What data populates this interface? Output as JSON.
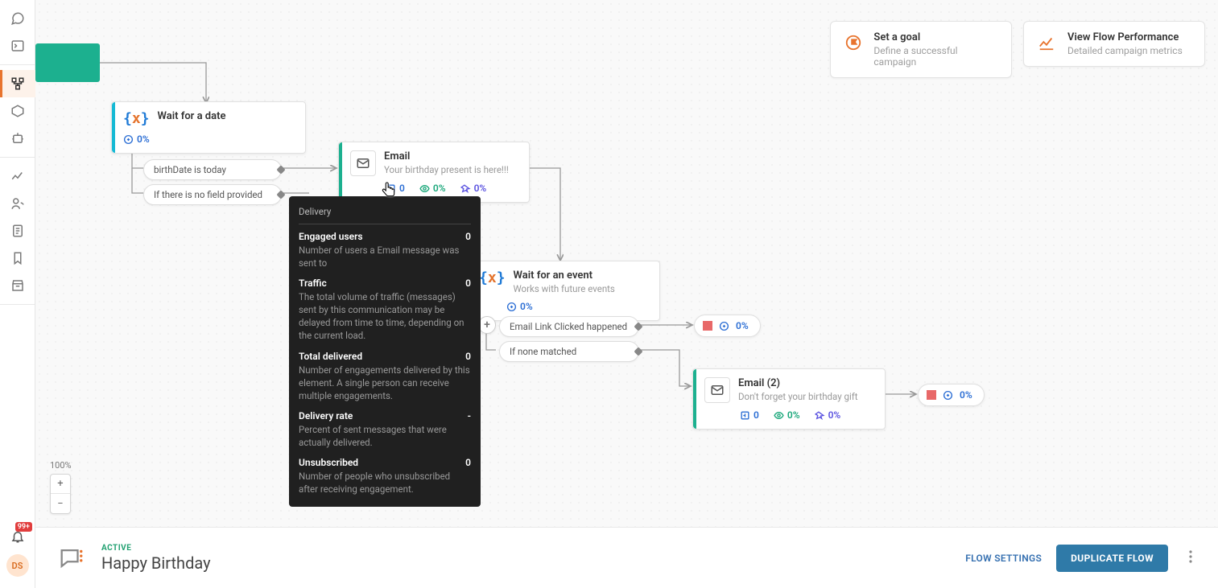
{
  "sidebar": {
    "notification_badge": "99+",
    "avatar": "DS"
  },
  "top_cards": {
    "goal": {
      "title": "Set a goal",
      "subtitle": "Define a successful campaign"
    },
    "performance": {
      "title": "View Flow Performance",
      "subtitle": "Detailed campaign metrics"
    }
  },
  "zoom": {
    "label": "100%"
  },
  "nodes": {
    "wait_date": {
      "title": "Wait for a date",
      "stat": "0%"
    },
    "email1": {
      "title": "Email",
      "subtitle": "Your birthday present is here!!!",
      "s1": "0",
      "s2": "0%",
      "s3": "0%"
    },
    "wait_event": {
      "title": "Wait for an event",
      "subtitle": "Works with future events",
      "stat": "0%"
    },
    "email2": {
      "title": "Email (2)",
      "subtitle": "Don't forget your birthday gift",
      "s1": "0",
      "s2": "0%",
      "s3": "0%"
    }
  },
  "pills": {
    "cond_birth": "birthDate is today",
    "cond_nofield": "If there is no field provided",
    "cond_click": "Email Link Clicked happened",
    "cond_nomatch": "If none matched"
  },
  "endpills": {
    "a": "0%",
    "b": "0%"
  },
  "tooltip": {
    "header": "Delivery",
    "rows": [
      {
        "t": "Engaged users",
        "v": "0",
        "d": "Number of users a Email message was sent to"
      },
      {
        "t": "Traffic",
        "v": "0",
        "d": "The total volume of traffic (messages) sent by this communication may be delayed from time to time, depending on the current load."
      },
      {
        "t": "Total delivered",
        "v": "0",
        "d": "Number of engagements delivered by this element. A single person can receive multiple engagements."
      },
      {
        "t": "Delivery rate",
        "v": "-",
        "d": "Percent of sent messages that were actually delivered."
      },
      {
        "t": "Unsubscribed",
        "v": "0",
        "d": "Number of people who unsubscribed after receiving engagement."
      }
    ]
  },
  "footer": {
    "status": "ACTIVE",
    "name": "Happy Birthday",
    "settings": "FLOW SETTINGS",
    "duplicate": "DUPLICATE FLOW"
  }
}
